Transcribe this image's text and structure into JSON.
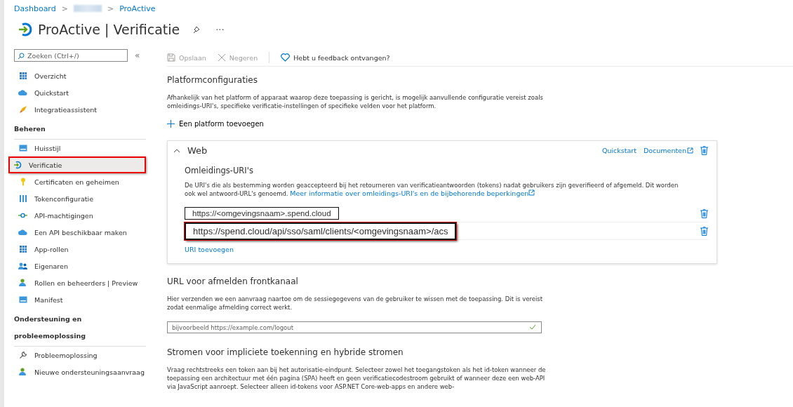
{
  "breadcrumb": {
    "separator": ">",
    "items": [
      {
        "label": "Dashboard",
        "kind": "link"
      },
      {
        "kind": "redacted"
      },
      {
        "label": "ProActive",
        "kind": "link"
      }
    ]
  },
  "title": {
    "app": "ProActive",
    "separator": "|",
    "page": "Verificatie",
    "more": "···"
  },
  "search": {
    "placeholder": "Zoeken (Ctrl+/)",
    "collapse": "«"
  },
  "sidebar": [
    {
      "kind": "item",
      "label": "Overzicht",
      "selected": false
    },
    {
      "kind": "item",
      "label": "Quickstart",
      "selected": false
    },
    {
      "kind": "item",
      "label": "Integratieassistent",
      "selected": false
    },
    {
      "kind": "heading",
      "label": "Beheren"
    },
    {
      "kind": "item",
      "label": "Huisstijl",
      "selected": false
    },
    {
      "kind": "item",
      "label": "Verificatie",
      "selected": true
    },
    {
      "kind": "item",
      "label": "Certificaten en geheimen",
      "selected": false
    },
    {
      "kind": "item",
      "label": "Tokenconfiguratie",
      "selected": false
    },
    {
      "kind": "item",
      "label": "API-machtigingen",
      "selected": false
    },
    {
      "kind": "item",
      "label": "Een API beschikbaar maken",
      "selected": false
    },
    {
      "kind": "item",
      "label": "App-rollen",
      "selected": false
    },
    {
      "kind": "item",
      "label": "Eigenaren",
      "selected": false
    },
    {
      "kind": "item",
      "label": "Rollen en beheerders | Preview",
      "selected": false
    },
    {
      "kind": "item",
      "label": "Manifest",
      "selected": false
    },
    {
      "kind": "heading",
      "label": "Ondersteuning en probleemoplossing"
    },
    {
      "kind": "item",
      "label": "Probleemoplossing",
      "selected": false
    },
    {
      "kind": "item",
      "label": "Nieuwe ondersteuningsaanvraag",
      "selected": false
    }
  ],
  "toolbar": [
    {
      "label": "Opslaan",
      "disabled": true
    },
    {
      "label": "Negeren",
      "disabled": true
    },
    {
      "label": "Hebt u feedback ontvangen?",
      "disabled": false
    }
  ],
  "platform": {
    "heading": "Platformconfiguraties",
    "text": "Afhankelijk van het platform of apparaat waarop deze toepassing is gericht, is mogelijk aanvullende configuratie vereist zoals omleidings-URI's, specifieke verificatie-instellingen of specifieke velden voor het platform.",
    "add": "Een platform toevoegen"
  },
  "web": {
    "title": "Web",
    "expanded": true,
    "links": [
      "Quickstart",
      "Documenten"
    ],
    "uri_heading": "Omleidings-URI's",
    "text": "De URI's die als bestemming worden geaccepteerd bij het retourneren van verificatieantwoorden (tokens) nadat gebruikers zijn geverifieerd of afgemeld. Dit worden ook wel antwoord-URL's genoemd.",
    "more_link": "Meer informatie over omleidings-URI's en de bijbehorende beperkingen",
    "uris": [
      "https://<omgevingsnaam>.spend.cloud",
      "https://spend.cloud/api/sso/saml/clients/<omgevingsnaam>/acs"
    ],
    "add_uri": "URI toevoegen"
  },
  "logout": {
    "heading": "URL voor afmelden frontkanaal",
    "text": "Hier verzenden we een aanvraag naartoe om de sessiegegevens van de gebruiker te wissen met de toepassing. Dit is vereist zodat eenmalige afmelding correct werkt.",
    "placeholder": "bijvoorbeeld https://example.com/logout",
    "valid": true
  },
  "implicit": {
    "heading": "Stromen voor impliciete toekenning en hybride stromen",
    "text": "Vraag rechtstreeks een token aan bij het autorisatie-eindpunt. Selecteer zowel het toegangstoken als het id-token wanneer de toepassing een architectuur met één pagina (SPA) heeft en geen verificatiecodestroom gebruikt of wanneer deze een web-API via JavaScript aanroept. Selecteer alleen id-tokens voor ASP.NET Core-web-apps en andere web-"
  }
}
